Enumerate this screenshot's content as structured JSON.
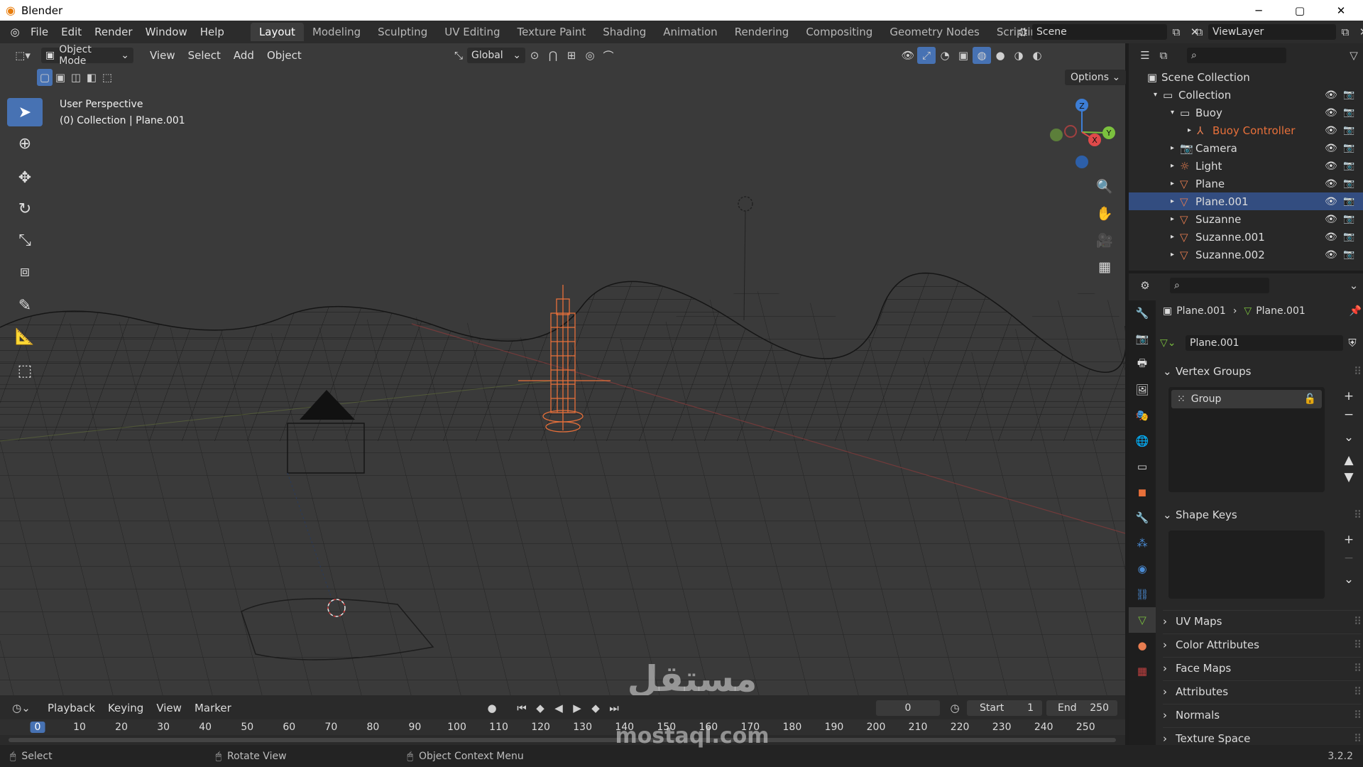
{
  "window": {
    "title": "Blender",
    "minimize": "─",
    "maximize": "▢",
    "close": "✕"
  },
  "menu": [
    "File",
    "Edit",
    "Render",
    "Window",
    "Help"
  ],
  "workspaces": [
    "Layout",
    "Modeling",
    "Sculpting",
    "UV Editing",
    "Texture Paint",
    "Shading",
    "Animation",
    "Rendering",
    "Compositing",
    "Geometry Nodes",
    "Scripting"
  ],
  "workspace_add": "+",
  "scene": {
    "name": "Scene"
  },
  "view_layer": {
    "name": "ViewLayer"
  },
  "viewport": {
    "mode": "Object Mode",
    "menus": [
      "View",
      "Select",
      "Add",
      "Object"
    ],
    "transform_orientation": "Global",
    "options_label": "Options",
    "overlay_text": {
      "line1": "User Perspective",
      "line2": "(0) Collection | Plane.001"
    },
    "gizmo": {
      "z": "Z",
      "y": "Y",
      "x": "X"
    }
  },
  "outliner": {
    "root": "Scene Collection",
    "items": [
      {
        "label": "Collection",
        "indent": 1,
        "icon": "collection"
      },
      {
        "label": "Buoy",
        "indent": 2,
        "icon": "collection"
      },
      {
        "label": "Buoy Controller",
        "indent": 3,
        "icon": "armature",
        "color": "#e8703a"
      },
      {
        "label": "Camera",
        "indent": 2,
        "icon": "camera"
      },
      {
        "label": "Light",
        "indent": 2,
        "icon": "light"
      },
      {
        "label": "Plane",
        "indent": 2,
        "icon": "mesh"
      },
      {
        "label": "Plane.001",
        "indent": 2,
        "icon": "mesh",
        "selected": true
      },
      {
        "label": "Suzanne",
        "indent": 2,
        "icon": "mesh"
      },
      {
        "label": "Suzanne.001",
        "indent": 2,
        "icon": "mesh"
      },
      {
        "label": "Suzanne.002",
        "indent": 2,
        "icon": "mesh"
      }
    ]
  },
  "properties": {
    "breadcrumb_object": "Plane.001",
    "breadcrumb_data": "Plane.001",
    "mesh_name": "Plane.001",
    "vertex_groups_title": "Vertex Groups",
    "vertex_group_item": "Group",
    "shape_keys_title": "Shape Keys",
    "collapsed_panels": [
      "UV Maps",
      "Color Attributes",
      "Face Maps",
      "Attributes",
      "Normals",
      "Texture Space"
    ]
  },
  "timeline": {
    "menus": [
      "Playback",
      "Keying",
      "View",
      "Marker"
    ],
    "current_frame": "0",
    "start_label": "Start",
    "start": "1",
    "end_label": "End",
    "end": "250",
    "ruler": [
      "0",
      "10",
      "20",
      "30",
      "40",
      "50",
      "60",
      "70",
      "80",
      "90",
      "100",
      "110",
      "120",
      "130",
      "140",
      "150",
      "160",
      "170",
      "180",
      "190",
      "200",
      "210",
      "220",
      "230",
      "240",
      "250"
    ]
  },
  "statusbar": {
    "select": "Select",
    "rotate": "Rotate View",
    "context": "Object Context Menu",
    "version": "3.2.2"
  },
  "watermark": {
    "arabic": "مستقل",
    "latin": "mostaql.com"
  },
  "colors": {
    "accent": "#4772b3",
    "selected_object": "#e8703a",
    "axis_x": "#e04a4a",
    "axis_y": "#7bc13e",
    "axis_z": "#3d7ed6"
  }
}
